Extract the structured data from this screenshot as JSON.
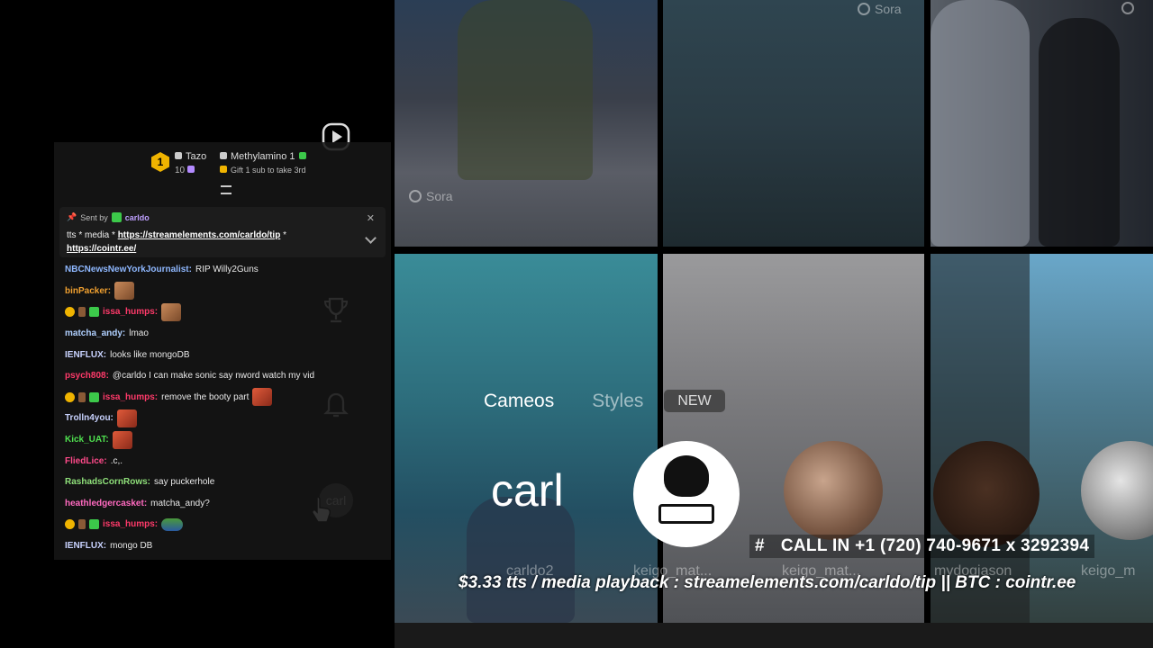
{
  "chat": {
    "hype": {
      "level": "1",
      "user1": "Tazo",
      "user1_count": "10",
      "user2": "Methylamino",
      "user2_count": "1",
      "status": "Gift 1 sub to take 3rd"
    },
    "pinned": {
      "sent_by_label": "Sent by",
      "sender": "carldo",
      "text": "tts * media *",
      "link1": "https://streamelements.com/carldo/tip",
      "sep": "*",
      "link2": "https://cointr.ee/"
    },
    "messages": [
      {
        "user": "NBCNewsNewYorkJournalist",
        "color": "#8fb8ff",
        "text": "RIP Willy2Guns",
        "badges": [],
        "emote": ""
      },
      {
        "user": "binPacker",
        "color": "#f0a030",
        "text": "",
        "badges": [],
        "emote": "brown"
      },
      {
        "user": "issa_humps",
        "color": "#ff3a6a",
        "text": "",
        "badges": [
          "gold",
          "brown",
          "green"
        ],
        "emote": "brown"
      },
      {
        "user": "matcha_andy",
        "color": "#b0d0ff",
        "text": "lmao",
        "badges": [],
        "emote": ""
      },
      {
        "user": "IENFLUX",
        "color": "#c9d3ff",
        "text": "looks like mongoDB",
        "badges": [],
        "emote": ""
      },
      {
        "user": "psych808",
        "color": "#ff3a6a",
        "text": "@carldo I can make sonic say nword watch my vid",
        "badges": [],
        "emote": ""
      },
      {
        "user": "issa_humps",
        "color": "#ff3a6a",
        "text": "remove the booty part",
        "badges": [
          "gold",
          "brown",
          "green"
        ],
        "emote": "red"
      },
      {
        "user": "Trolln4you",
        "color": "#c9d3ff",
        "text": "",
        "badges": [],
        "emote": "red"
      },
      {
        "user": "Kick_UAT",
        "color": "#4fe04f",
        "text": "",
        "badges": [],
        "emote": "red"
      },
      {
        "user": "FliedLice",
        "color": "#ff4a8a",
        "text": ".c,.",
        "badges": [],
        "emote": ""
      },
      {
        "user": "RashadsCornRows",
        "color": "#8fe07a",
        "text": "say puckerhole",
        "badges": [],
        "emote": ""
      },
      {
        "user": "heathledgercasket",
        "color": "#ff6ac0",
        "text": "matcha_andy?",
        "badges": [],
        "emote": ""
      },
      {
        "user": "issa_humps",
        "color": "#ff3a6a",
        "text": "",
        "badges": [
          "gold",
          "brown",
          "green"
        ],
        "emote": "frog"
      },
      {
        "user": "IENFLUX",
        "color": "#c9d3ff",
        "text": "mongo DB",
        "badges": [],
        "emote": ""
      }
    ]
  },
  "sora": {
    "watermark": "Sora",
    "tabs": [
      "Cameos",
      "Styles"
    ],
    "new_badge": "NEW",
    "cameo_title": "carl",
    "cameo_names": [
      "carldo2",
      "keigo_mat...",
      "keigo_mat...",
      "mydogjason",
      "keigo_m"
    ],
    "side_carl_label": "carl"
  },
  "overlay": {
    "callin_hash": "#",
    "callin": "CALL IN +1 (720) 740-9671 x 3292394",
    "ticker": "$3.33 tts / media playback : streamelements.com/carldo/tip || BTC : cointr.ee"
  },
  "colors": {
    "accent_gold": "#f0b400",
    "sub_green": "#3cc94a"
  },
  "icons": [
    "play-icon",
    "search-icon",
    "trophy-icon",
    "bell-icon",
    "cursor-icon",
    "pin-icon",
    "close-icon",
    "chevron-down-icon"
  ]
}
